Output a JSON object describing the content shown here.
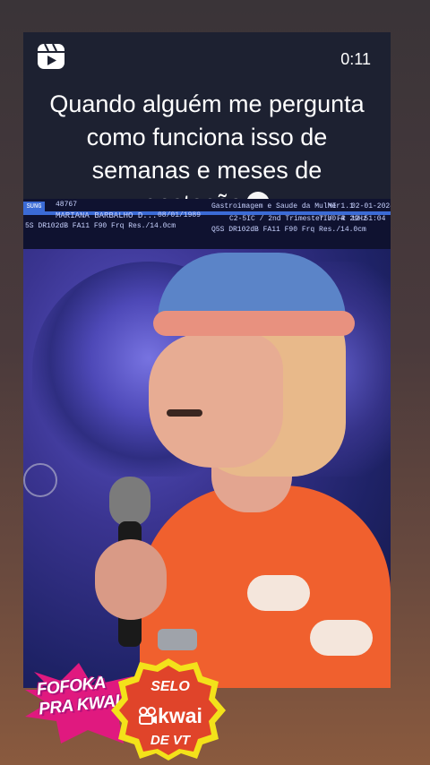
{
  "player": {
    "app_icon": "reels-icon",
    "time": "0:11",
    "caption_lines": [
      "Quando alguém me pergunta",
      "como funciona isso de",
      "semanas e meses de",
      "gestação"
    ],
    "caption_emoji": "clown-face-icon"
  },
  "ultrasound": {
    "logo": "SUNG",
    "patient_id": "48767",
    "patient_name": "MARIANA BARBALHO D...",
    "birth_date": "08/01/1989",
    "clinic": "Gastroimagem e Saude da Mulher",
    "probe": "C2-5IC / 2nd Trimester / FR 29Hz",
    "mi": "MI 1.1",
    "tib": "TIb0.4",
    "date": "02-01-2024",
    "clock": "12:51:04",
    "params_left": "5S DR102dB FA11 F90 Frq Res./14.0cm",
    "params_right": "Q5S DR102dB FA11 F90 Frq Res./14.0cm"
  },
  "stickers": {
    "fofoka_lines": [
      "FOFOKA",
      "PRA KWAI"
    ],
    "selo_top": "SELO",
    "selo_brand": "kwai",
    "selo_bottom": "DE VT",
    "colors": {
      "fofoka_pink": "#e0197f",
      "selo_red": "#e0442a",
      "selo_yellow": "#f3e21a"
    }
  }
}
